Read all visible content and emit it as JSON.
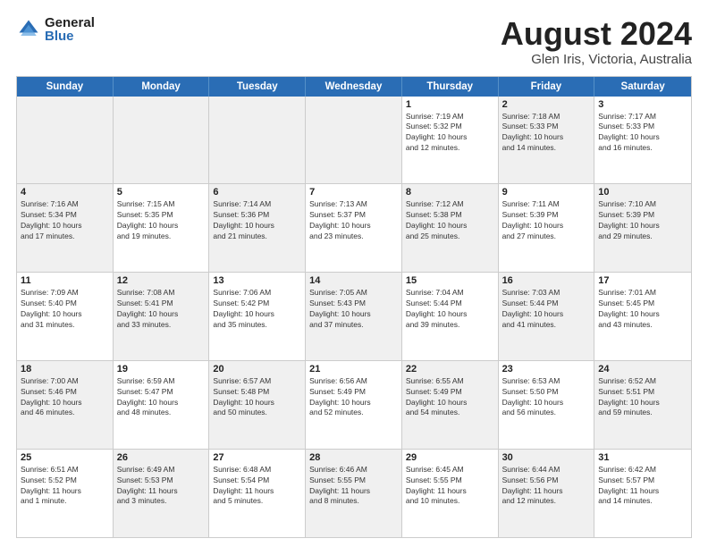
{
  "logo": {
    "general": "General",
    "blue": "Blue"
  },
  "title": "August 2024",
  "subtitle": "Glen Iris, Victoria, Australia",
  "header_days": [
    "Sunday",
    "Monday",
    "Tuesday",
    "Wednesday",
    "Thursday",
    "Friday",
    "Saturday"
  ],
  "weeks": [
    [
      {
        "day": "",
        "text": "",
        "shaded": true
      },
      {
        "day": "",
        "text": "",
        "shaded": true
      },
      {
        "day": "",
        "text": "",
        "shaded": true
      },
      {
        "day": "",
        "text": "",
        "shaded": true
      },
      {
        "day": "1",
        "text": "Sunrise: 7:19 AM\nSunset: 5:32 PM\nDaylight: 10 hours\nand 12 minutes."
      },
      {
        "day": "2",
        "text": "Sunrise: 7:18 AM\nSunset: 5:33 PM\nDaylight: 10 hours\nand 14 minutes.",
        "shaded": true
      },
      {
        "day": "3",
        "text": "Sunrise: 7:17 AM\nSunset: 5:33 PM\nDaylight: 10 hours\nand 16 minutes."
      }
    ],
    [
      {
        "day": "4",
        "text": "Sunrise: 7:16 AM\nSunset: 5:34 PM\nDaylight: 10 hours\nand 17 minutes.",
        "shaded": true
      },
      {
        "day": "5",
        "text": "Sunrise: 7:15 AM\nSunset: 5:35 PM\nDaylight: 10 hours\nand 19 minutes."
      },
      {
        "day": "6",
        "text": "Sunrise: 7:14 AM\nSunset: 5:36 PM\nDaylight: 10 hours\nand 21 minutes.",
        "shaded": true
      },
      {
        "day": "7",
        "text": "Sunrise: 7:13 AM\nSunset: 5:37 PM\nDaylight: 10 hours\nand 23 minutes."
      },
      {
        "day": "8",
        "text": "Sunrise: 7:12 AM\nSunset: 5:38 PM\nDaylight: 10 hours\nand 25 minutes.",
        "shaded": true
      },
      {
        "day": "9",
        "text": "Sunrise: 7:11 AM\nSunset: 5:39 PM\nDaylight: 10 hours\nand 27 minutes."
      },
      {
        "day": "10",
        "text": "Sunrise: 7:10 AM\nSunset: 5:39 PM\nDaylight: 10 hours\nand 29 minutes.",
        "shaded": true
      }
    ],
    [
      {
        "day": "11",
        "text": "Sunrise: 7:09 AM\nSunset: 5:40 PM\nDaylight: 10 hours\nand 31 minutes."
      },
      {
        "day": "12",
        "text": "Sunrise: 7:08 AM\nSunset: 5:41 PM\nDaylight: 10 hours\nand 33 minutes.",
        "shaded": true
      },
      {
        "day": "13",
        "text": "Sunrise: 7:06 AM\nSunset: 5:42 PM\nDaylight: 10 hours\nand 35 minutes."
      },
      {
        "day": "14",
        "text": "Sunrise: 7:05 AM\nSunset: 5:43 PM\nDaylight: 10 hours\nand 37 minutes.",
        "shaded": true
      },
      {
        "day": "15",
        "text": "Sunrise: 7:04 AM\nSunset: 5:44 PM\nDaylight: 10 hours\nand 39 minutes."
      },
      {
        "day": "16",
        "text": "Sunrise: 7:03 AM\nSunset: 5:44 PM\nDaylight: 10 hours\nand 41 minutes.",
        "shaded": true
      },
      {
        "day": "17",
        "text": "Sunrise: 7:01 AM\nSunset: 5:45 PM\nDaylight: 10 hours\nand 43 minutes."
      }
    ],
    [
      {
        "day": "18",
        "text": "Sunrise: 7:00 AM\nSunset: 5:46 PM\nDaylight: 10 hours\nand 46 minutes.",
        "shaded": true
      },
      {
        "day": "19",
        "text": "Sunrise: 6:59 AM\nSunset: 5:47 PM\nDaylight: 10 hours\nand 48 minutes."
      },
      {
        "day": "20",
        "text": "Sunrise: 6:57 AM\nSunset: 5:48 PM\nDaylight: 10 hours\nand 50 minutes.",
        "shaded": true
      },
      {
        "day": "21",
        "text": "Sunrise: 6:56 AM\nSunset: 5:49 PM\nDaylight: 10 hours\nand 52 minutes."
      },
      {
        "day": "22",
        "text": "Sunrise: 6:55 AM\nSunset: 5:49 PM\nDaylight: 10 hours\nand 54 minutes.",
        "shaded": true
      },
      {
        "day": "23",
        "text": "Sunrise: 6:53 AM\nSunset: 5:50 PM\nDaylight: 10 hours\nand 56 minutes."
      },
      {
        "day": "24",
        "text": "Sunrise: 6:52 AM\nSunset: 5:51 PM\nDaylight: 10 hours\nand 59 minutes.",
        "shaded": true
      }
    ],
    [
      {
        "day": "25",
        "text": "Sunrise: 6:51 AM\nSunset: 5:52 PM\nDaylight: 11 hours\nand 1 minute."
      },
      {
        "day": "26",
        "text": "Sunrise: 6:49 AM\nSunset: 5:53 PM\nDaylight: 11 hours\nand 3 minutes.",
        "shaded": true
      },
      {
        "day": "27",
        "text": "Sunrise: 6:48 AM\nSunset: 5:54 PM\nDaylight: 11 hours\nand 5 minutes."
      },
      {
        "day": "28",
        "text": "Sunrise: 6:46 AM\nSunset: 5:55 PM\nDaylight: 11 hours\nand 8 minutes.",
        "shaded": true
      },
      {
        "day": "29",
        "text": "Sunrise: 6:45 AM\nSunset: 5:55 PM\nDaylight: 11 hours\nand 10 minutes."
      },
      {
        "day": "30",
        "text": "Sunrise: 6:44 AM\nSunset: 5:56 PM\nDaylight: 11 hours\nand 12 minutes.",
        "shaded": true
      },
      {
        "day": "31",
        "text": "Sunrise: 6:42 AM\nSunset: 5:57 PM\nDaylight: 11 hours\nand 14 minutes."
      }
    ]
  ]
}
